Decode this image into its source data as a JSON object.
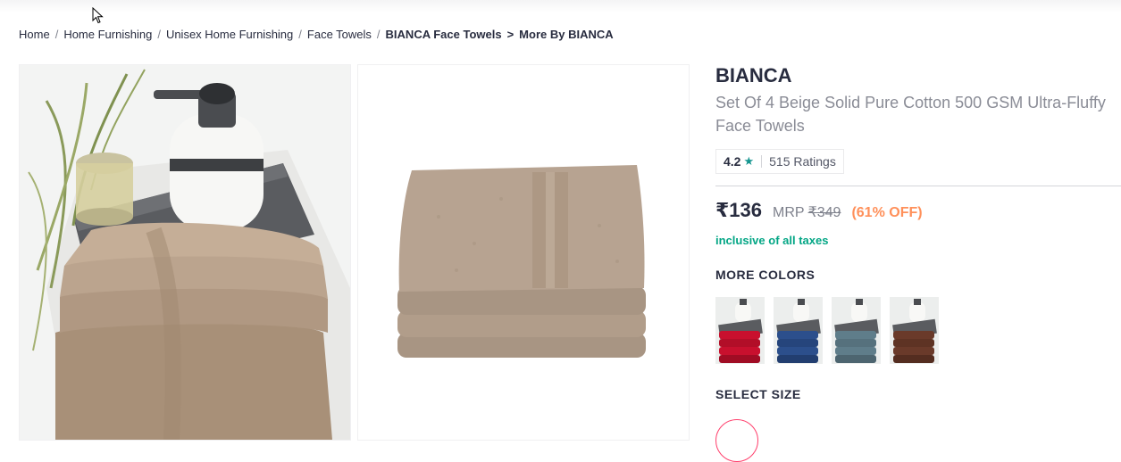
{
  "breadcrumb": {
    "items": [
      "Home",
      "Home Furnishing",
      "Unisex Home Furnishing",
      "Face Towels"
    ],
    "current": "BIANCA Face Towels",
    "more": "More By BIANCA"
  },
  "product": {
    "brand": "BIANCA",
    "title": "Set Of 4 Beige Solid Pure Cotton 500 GSM Ultra-Fluffy Face Towels",
    "rating": {
      "score": "4.2",
      "star_icon": "star-icon",
      "count_text": "515 Ratings"
    },
    "price": "₹136",
    "mrp_label": "MRP",
    "mrp_value": "₹349",
    "discount": "(61% OFF)",
    "tax_note": "inclusive of all taxes"
  },
  "more_colors": {
    "heading": "MORE COLORS",
    "swatches": [
      {
        "color": "#c8102e"
      },
      {
        "color": "#2c4f8c"
      },
      {
        "color": "#5f7d8a"
      },
      {
        "color": "#6a3a2a"
      }
    ]
  },
  "size": {
    "heading": "SELECT SIZE"
  },
  "colors": {
    "towel": "#b79f8a",
    "accent_pink": "#ff3f6c",
    "discount_orange": "#ff905a",
    "tax_green": "#03a685",
    "star_teal": "#14958f"
  }
}
